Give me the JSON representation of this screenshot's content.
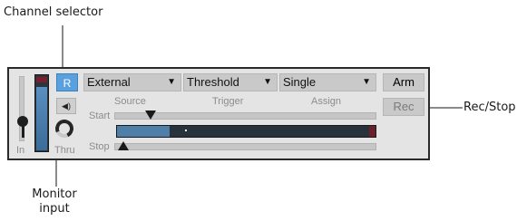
{
  "callouts": {
    "channel_selector": "Channel selector",
    "rec_stop": "Rec/Stop",
    "monitor_input": "Monitor\ninput"
  },
  "panel": {
    "in_label": "In",
    "thru_label": "Thru",
    "channel_button": "R",
    "monitor_icon": "speaker-icon",
    "dropdowns": {
      "source": {
        "value": "External",
        "label": "Source"
      },
      "trigger": {
        "value": "Threshold",
        "label": "Trigger"
      },
      "assign": {
        "value": "Single",
        "label": "Assign"
      }
    },
    "start_label": "Start",
    "stop_label": "Stop",
    "arm_button": "Arm",
    "rec_button": "Rec",
    "arrow_glyph": "▼",
    "speaker_glyph": "◀)"
  },
  "colors": {
    "channel_button_bg": "#5aa0df",
    "meter_blue": "#3b6c99",
    "meter_red": "#7a1f2b",
    "panel_bg": "#e4e4e4"
  }
}
